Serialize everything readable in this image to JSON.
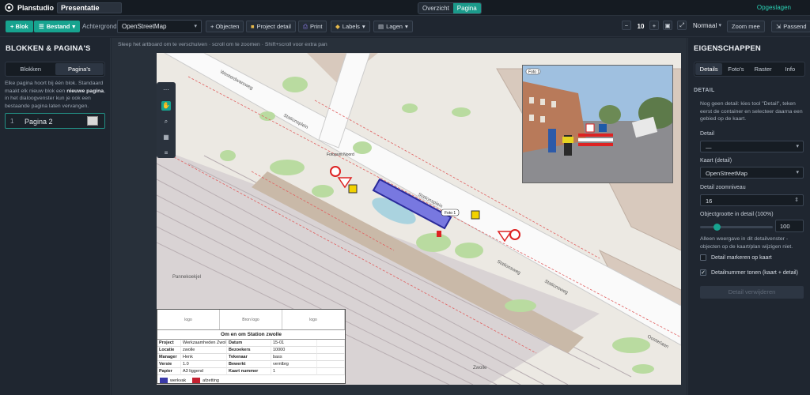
{
  "app": {
    "name": "Planstudio",
    "project_name": "Presentatie",
    "saved": "Opgeslagen"
  },
  "view": {
    "tabs": [
      "Overzicht",
      "Pagina"
    ],
    "active": "Pagina"
  },
  "toolbar": {
    "add_block": "+ Blok",
    "existing": "Bestand",
    "background_label": "Achtergrond",
    "background_value": "OpenStreetMap",
    "objects": "+ Objecten",
    "project_detail": "Project detail",
    "print": "Print",
    "labels": "Labels",
    "layers": "Lagen",
    "zoom_value": "10",
    "zoom_mode": "Normaal",
    "zoom_with": "Zoom mee",
    "fit": "Passend"
  },
  "left": {
    "title": "BLOKKEN & PAGINA'S",
    "tabs": [
      "Blokken",
      "Pagina's"
    ],
    "active_tab": "Pagina's",
    "help_a": "Elke pagina hoort bij één blok. Standaard maakt elk nieuw blok een ",
    "help_bold": "nieuwe pagina",
    "help_b": ", in het dialoogvenster kun je ook een bestaande pagina laten vervangen.",
    "pages": [
      {
        "num": "1",
        "name": "Pagina 2"
      }
    ]
  },
  "canvas": {
    "hint": "Sleep het artboard om te verschuiven · scroll om te zoomen · Shift+scroll voor extra pan",
    "street_labels": [
      "Westerdwarsweg",
      "Stationsplein",
      "Stationsplein",
      "Stationsweg",
      "Stationsweg",
      "Oosterlaan",
      "Pannekoekjel",
      "Zwolle"
    ],
    "markers": [
      "Fotopunt Noord",
      "Foto 1",
      "Foto 1"
    ],
    "photo_label": "Foto 1"
  },
  "titleblock": {
    "logos": [
      "logo",
      "Bron logo",
      "logo"
    ],
    "title": "Om en om Station zwolle",
    "rows": [
      [
        "Project",
        "Werkzaamheden Zwolle",
        "Datum",
        "15-01"
      ],
      [
        "Locatie",
        "zwolle",
        "Bezoekers",
        "10000"
      ],
      [
        "Manager",
        "Henk",
        "Tekenaar",
        "bass"
      ],
      [
        "Versie",
        "1.0",
        "Bewerkt",
        "vernlbrg"
      ],
      [
        "Papier",
        "A3 liggend",
        "Kaart nummer",
        "1"
      ]
    ],
    "legend": [
      {
        "label": "werkvak",
        "color": "#3a3aa8"
      },
      {
        "label": "afzetting",
        "color": "#c32030"
      }
    ]
  },
  "right": {
    "title": "EIGENSCHAPPEN",
    "tabs": [
      "Details",
      "Foto's",
      "Raster",
      "Info"
    ],
    "active_tab": "Details",
    "section": "DETAIL",
    "text": "Nog geen detail: kies tool \"Detail\", teken eerst de container en selecteer daarna een gebied op de kaart.",
    "detail_label": "Detail",
    "detail_value": "—",
    "map_label": "Kaart (detail)",
    "map_value": "OpenStreetMap",
    "zoom_label": "Detail zoomniveau",
    "zoom_value": "16",
    "size_label": "Objectgrootte in detail (100%)",
    "size_value": "100",
    "size_fraction": 0.18,
    "note": "Alleen weergave in dit detailvenster - objecten op de kaart/plan wijzigen niet.",
    "check1": "Detail markeren op kaart",
    "check2": "Detailnummer tonen (kaart + detail)",
    "disabled_button": "Detail verwijderen"
  },
  "colors": {
    "accent": "#17a38f",
    "panel": "#1f2630"
  }
}
